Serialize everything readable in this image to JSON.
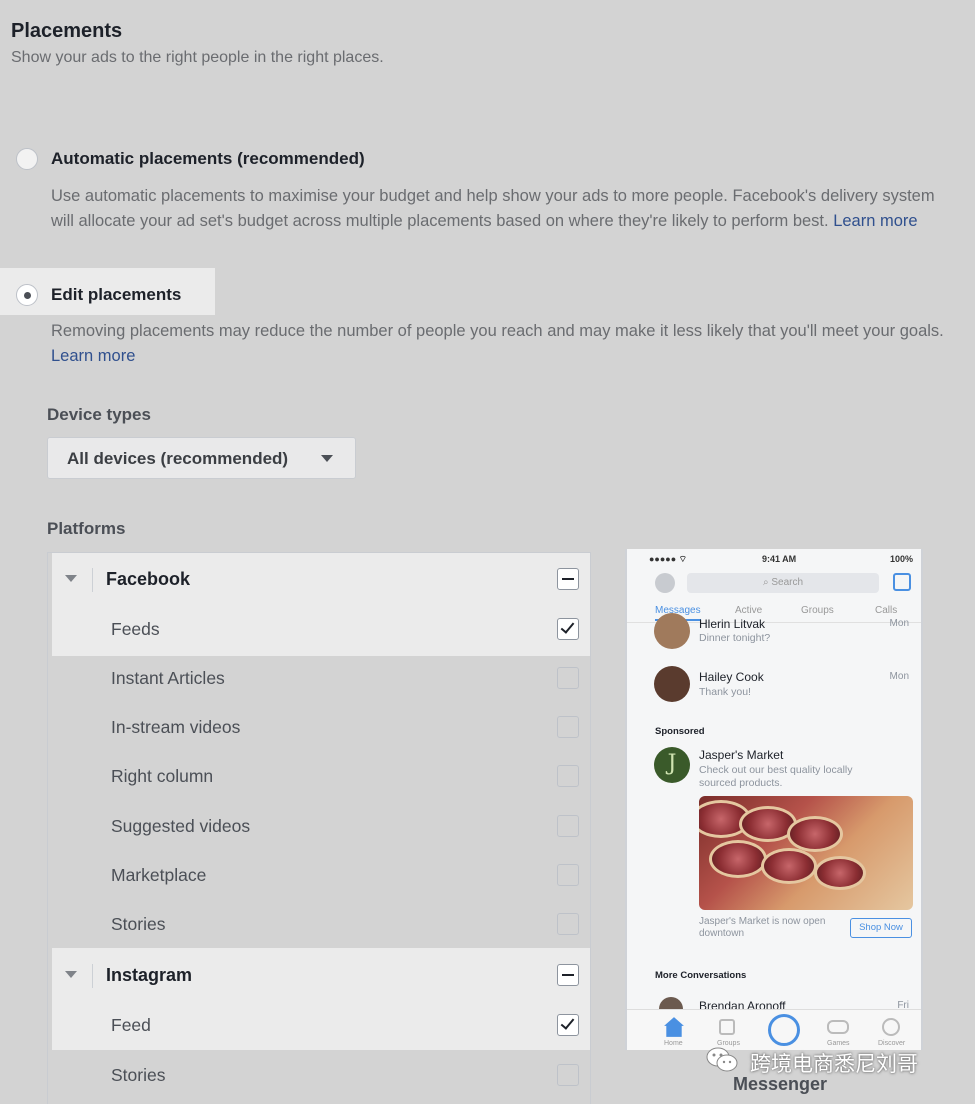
{
  "header": {
    "title": "Placements",
    "subtitle": "Show your ads to the right people in the right places."
  },
  "placement_options": {
    "automatic": {
      "label": "Automatic placements (recommended)",
      "selected": false,
      "description": "Use automatic placements to maximise your budget and help show your ads to more people. Facebook's delivery system will allocate your ad set's budget across multiple placements based on where they're likely to perform best.",
      "learn_more": "Learn more"
    },
    "edit": {
      "label": "Edit placements",
      "selected": true,
      "description": "Removing placements may reduce the number of people you reach and may make it less likely that you'll meet your goals.",
      "learn_more": "Learn more"
    }
  },
  "device_types": {
    "label": "Device types",
    "selected": "All devices (recommended)",
    "icon": "caret-down-icon"
  },
  "platforms": {
    "label": "Platforms",
    "groups": [
      {
        "name": "Facebook",
        "state": "partial",
        "items": [
          {
            "label": "Feeds",
            "checked": true
          },
          {
            "label": "Instant Articles",
            "checked": false
          },
          {
            "label": "In-stream videos",
            "checked": false
          },
          {
            "label": "Right column",
            "checked": false
          },
          {
            "label": "Suggested videos",
            "checked": false
          },
          {
            "label": "Marketplace",
            "checked": false
          },
          {
            "label": "Stories",
            "checked": false
          }
        ]
      },
      {
        "name": "Instagram",
        "state": "partial",
        "items": [
          {
            "label": "Feed",
            "checked": true
          },
          {
            "label": "Stories",
            "checked": false
          }
        ]
      }
    ]
  },
  "preview": {
    "status_bar": {
      "carrier": "●●●●● ⌔",
      "time": "9:41 AM",
      "battery": "100%"
    },
    "search_placeholder": "Search",
    "tabs": [
      "Messages",
      "Active",
      "Groups",
      "Calls"
    ],
    "active_tab": "Messages",
    "conversations": [
      {
        "name": "Hlerin Litvak",
        "preview": "Dinner tonight?",
        "time": "Mon"
      },
      {
        "name": "Hailey Cook",
        "preview": "Thank you!",
        "time": "Mon"
      }
    ],
    "sponsored_label": "Sponsored",
    "ad": {
      "advertiser": "Jasper's Market",
      "text": "Check out our best quality locally sourced products.",
      "caption": "Jasper's Market is now open downtown",
      "cta": "Shop Now",
      "logo_letter": "J"
    },
    "more_label": "More Conversations",
    "more_conversation": {
      "name": "Brendan Aronoff",
      "time": "Fri"
    },
    "bottom_nav": [
      "Home",
      "Groups",
      "",
      "Games",
      "Discover"
    ],
    "caption": "Messenger"
  },
  "watermark": {
    "text": "跨境电商悉尼刘哥",
    "icon": "wechat-icon"
  },
  "colors": {
    "background": "#e5e5e5",
    "highlight": "#ffffff",
    "link": "#30508e",
    "messenger_blue": "#4a90e2"
  }
}
